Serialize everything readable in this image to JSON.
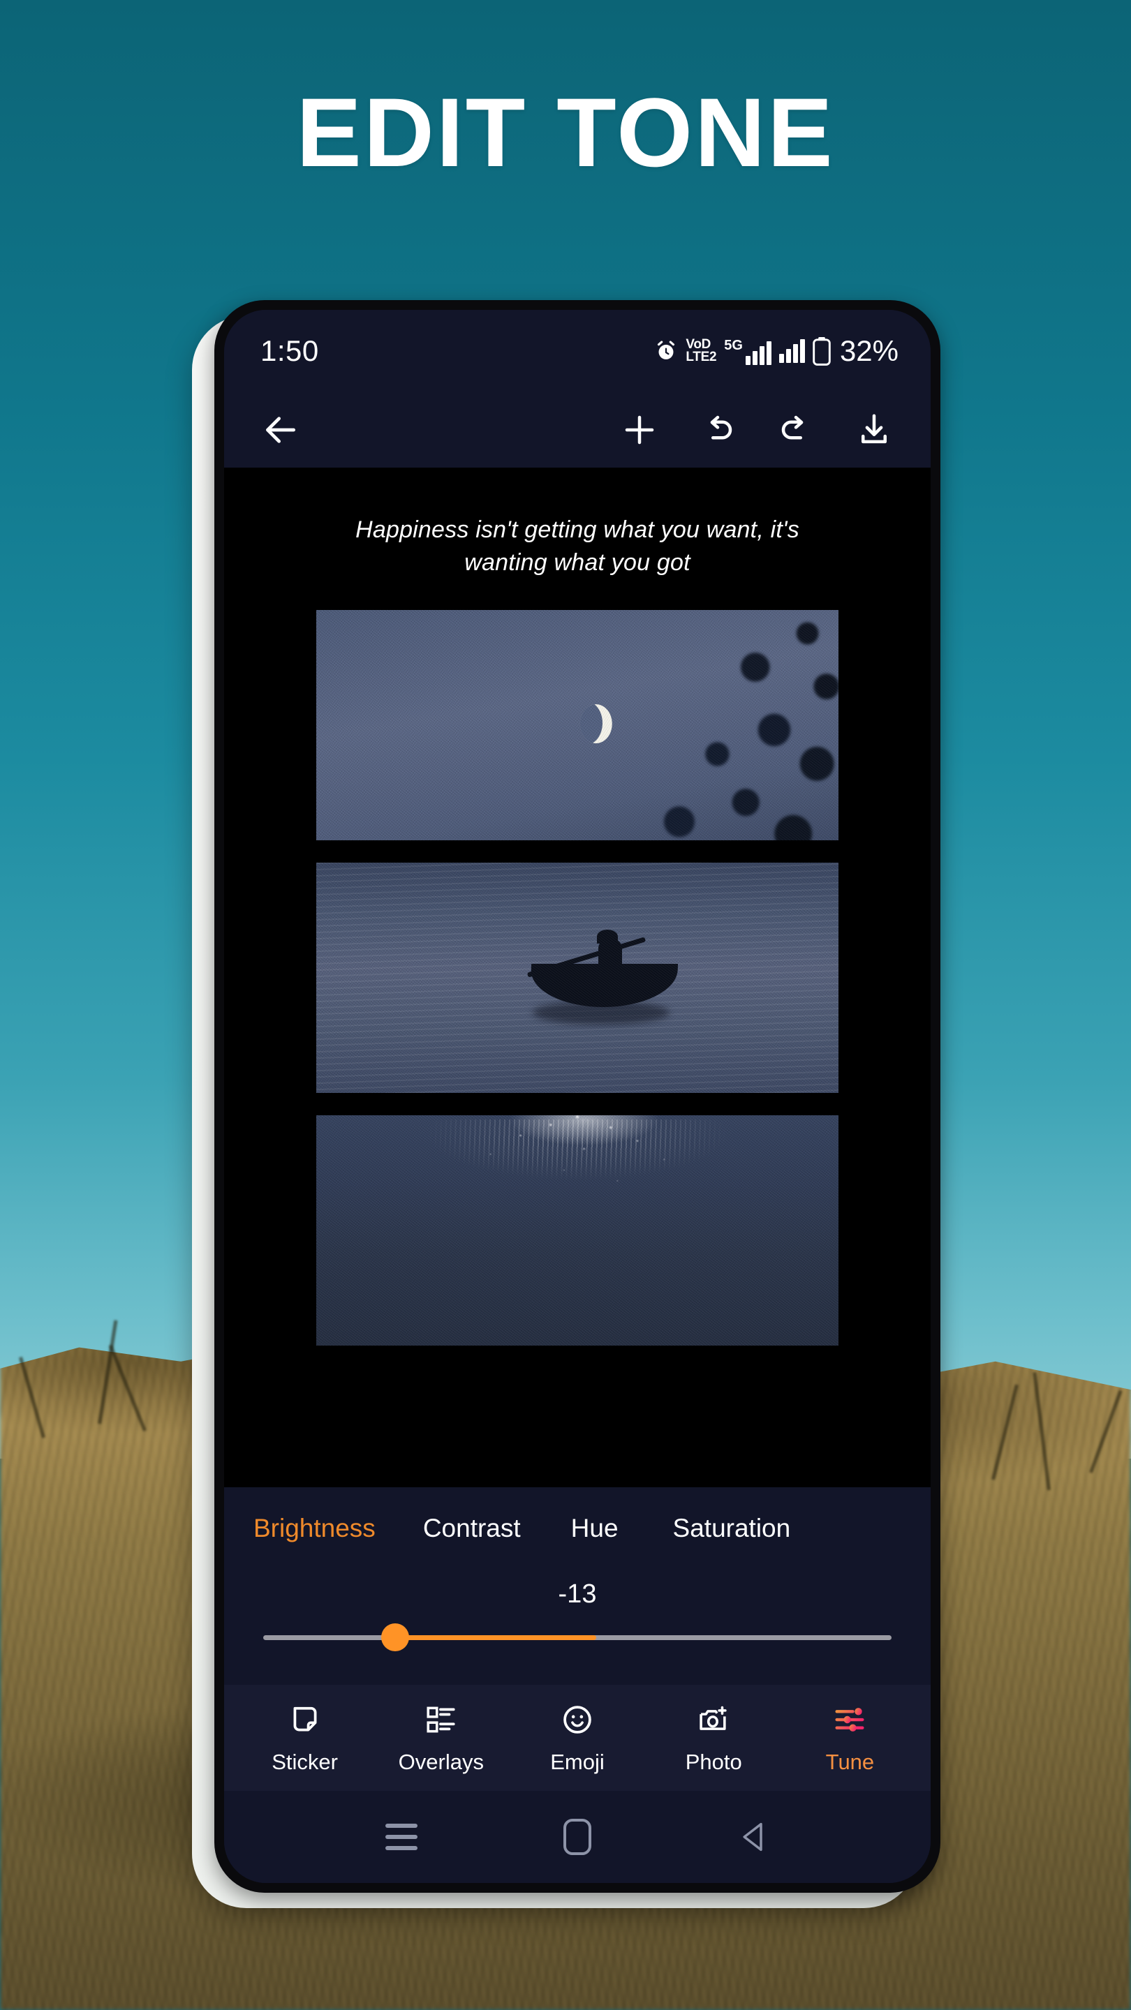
{
  "headline": "EDIT TONE",
  "status_bar": {
    "time": "1:50",
    "alarm_icon": "alarm-clock-icon",
    "volte_line1": "VoD",
    "volte_line2": "LTE2",
    "network_label": "5G",
    "battery_percent": "32%"
  },
  "toolbar": {
    "back_icon": "back-arrow-icon",
    "add_icon": "plus-icon",
    "undo_icon": "undo-icon",
    "redo_icon": "redo-icon",
    "download_icon": "download-icon"
  },
  "canvas": {
    "quote": "Happiness isn't getting what you want, it's wanting what you got",
    "photos": [
      {
        "caption": "crescent moon in night sky with tree silhouettes"
      },
      {
        "caption": "silhouette of person rowing a boat on a lake at night"
      },
      {
        "caption": "moonlight shimmering on dark water"
      }
    ]
  },
  "tune": {
    "tabs": [
      {
        "label": "Brightness",
        "active": true
      },
      {
        "label": "Contrast",
        "active": false
      },
      {
        "label": "Hue",
        "active": false
      },
      {
        "label": "Saturation",
        "active": false
      }
    ],
    "value": "-13",
    "slider": {
      "thumb_percent": 21,
      "fill_end_percent": 53
    },
    "accent_color": "#ef8a2b",
    "thumb_color": "#ff9326",
    "track_color": "#9b9ba3"
  },
  "app_nav": [
    {
      "label": "Sticker",
      "icon": "sticker-icon",
      "active": false
    },
    {
      "label": "Overlays",
      "icon": "overlays-icon",
      "active": false
    },
    {
      "label": "Emoji",
      "icon": "emoji-icon",
      "active": false
    },
    {
      "label": "Photo",
      "icon": "camera-add-icon",
      "active": false
    },
    {
      "label": "Tune",
      "icon": "tune-sliders-icon",
      "active": true
    }
  ],
  "system_nav": {
    "recents_icon": "recents-icon",
    "home_icon": "home-icon",
    "back_icon": "back-triangle-icon"
  },
  "colors": {
    "background_sky": "#10778c",
    "background_grass": "#8f7a45",
    "screen_bg": "#121529",
    "canvas_bg": "#000000",
    "accent_orange": "#f59041"
  }
}
